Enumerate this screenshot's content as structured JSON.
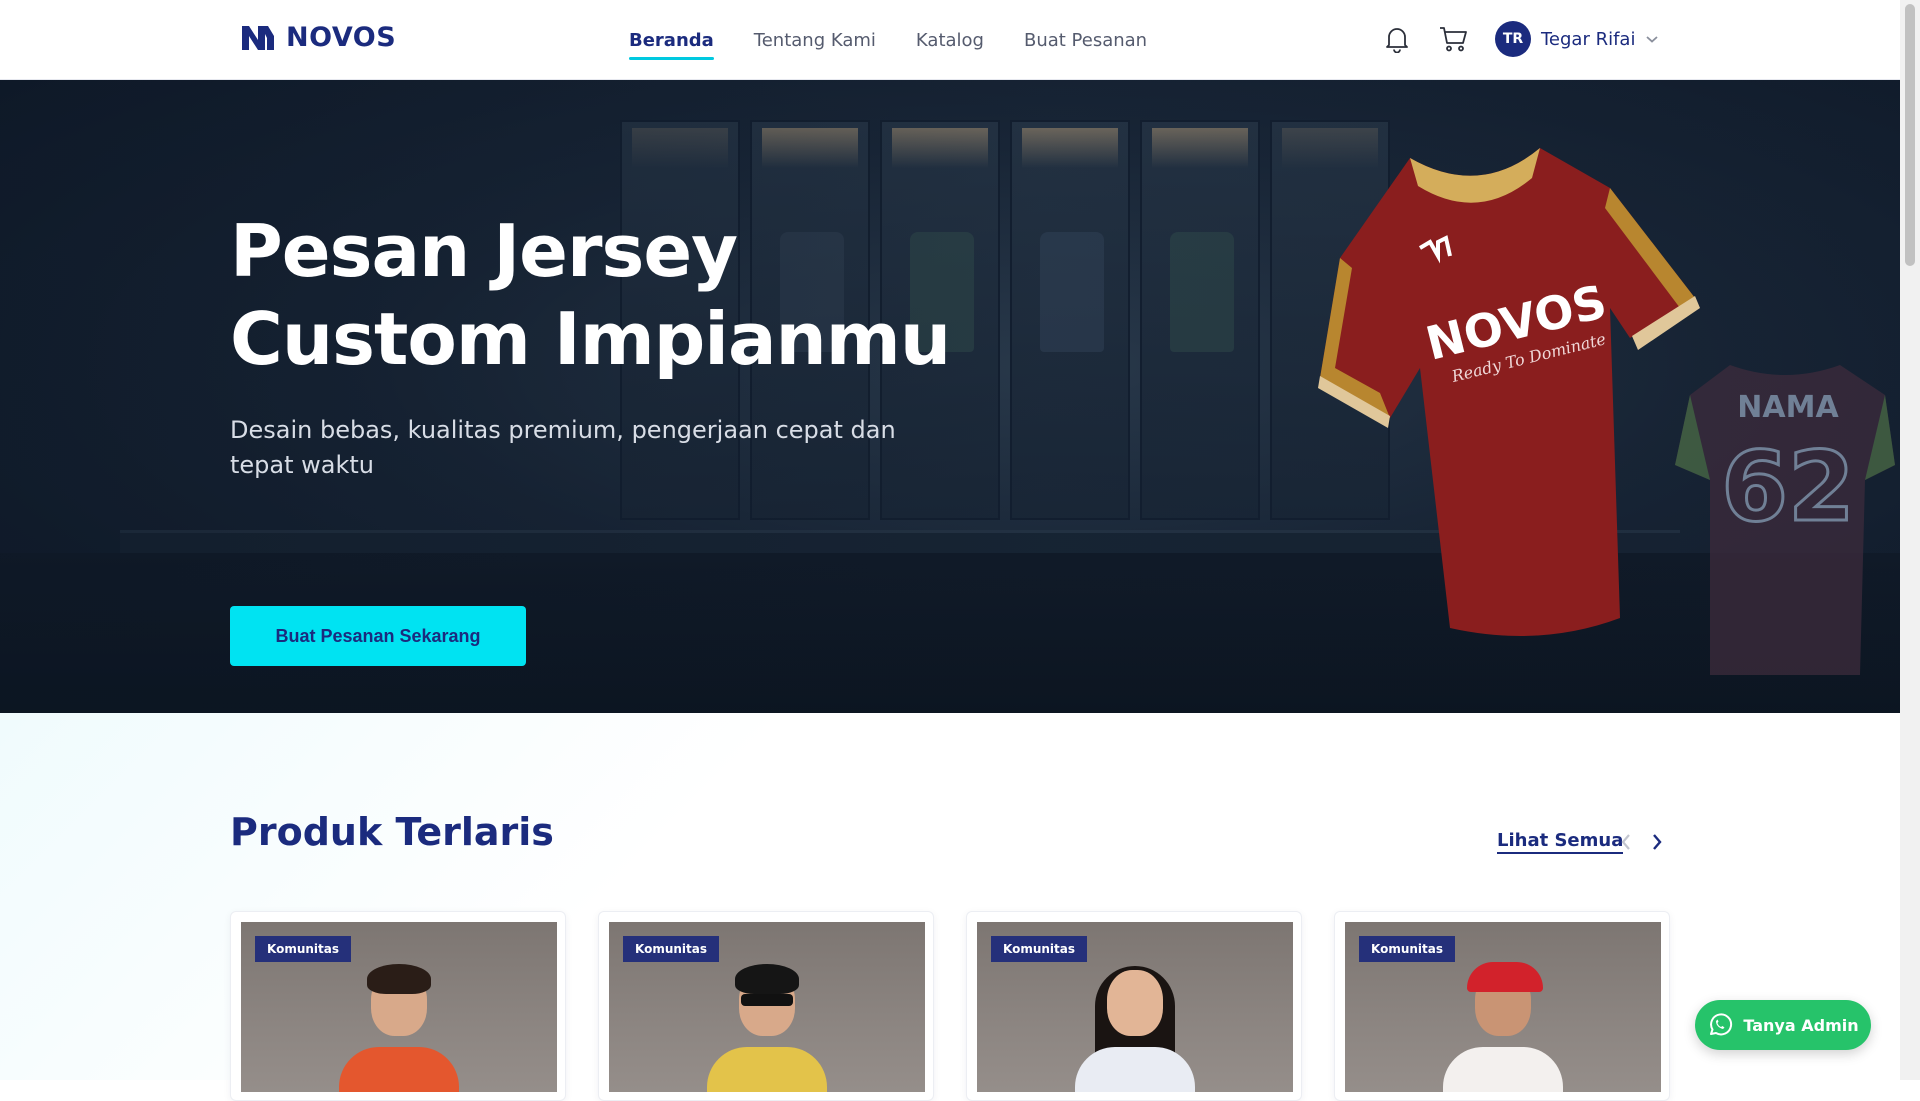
{
  "brand": {
    "name": "NOVOS"
  },
  "nav": {
    "links": [
      {
        "label": "Beranda",
        "active": true
      },
      {
        "label": "Tentang Kami",
        "active": false
      },
      {
        "label": "Katalog",
        "active": false
      },
      {
        "label": "Buat Pesanan",
        "active": false
      }
    ],
    "icons": [
      "bell-icon",
      "cart-icon"
    ],
    "user": {
      "initials": "TR",
      "name": "Tegar Rifai"
    }
  },
  "hero": {
    "title_line1": "Pesan Jersey",
    "title_line2": "Custom Impianmu",
    "subtitle": "Desain bebas, kualitas premium, pengerjaan cepat dan tepat waktu",
    "cta": "Buat Pesanan Sekarang",
    "jersey_text": "NOVOS",
    "jersey_tagline": "Ready To Dominate",
    "back_name": "NAMA",
    "back_number": "62"
  },
  "products": {
    "title": "Produk Terlaris",
    "see_all": "Lihat Semua",
    "cards": [
      {
        "badge": "Komunitas",
        "shirt_color": "#e4572e"
      },
      {
        "badge": "Komunitas",
        "shirt_color": "#e3c34a"
      },
      {
        "badge": "Komunitas",
        "shirt_color": "#e9ecf3"
      },
      {
        "badge": "Komunitas",
        "shirt_color": "#f3f0ee"
      }
    ]
  },
  "whatsapp": {
    "label": "Tanya Admin"
  },
  "colors": {
    "primary": "#1b2b7e",
    "accent": "#00e3f2",
    "whatsapp": "#26c36a"
  }
}
